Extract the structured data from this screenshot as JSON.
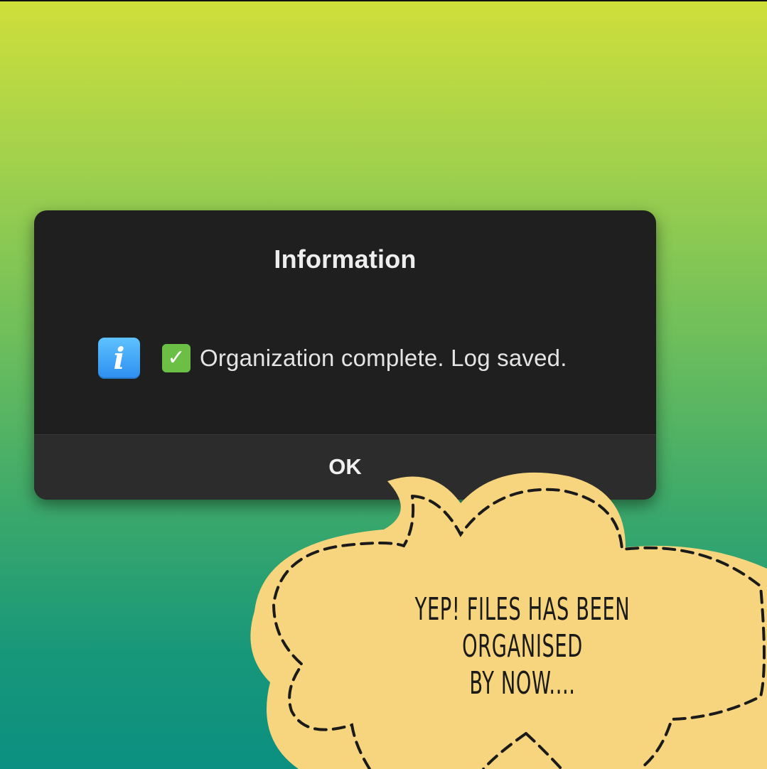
{
  "dialog": {
    "title": "Information",
    "info_icon_glyph": "i",
    "check_icon_glyph": "✓",
    "message": "Organization complete. Log saved.",
    "ok_label": "OK"
  },
  "callout": {
    "line1": "YEP! FILES HAS BEEN ORGANISED",
    "line2": "BY NOW....",
    "fill_color": "#f7d57e"
  },
  "colors": {
    "dialog_bg": "#1f1f1f",
    "footer_bg": "#2c2c2c",
    "info_blue": "#2d8ef0",
    "check_green": "#6cbf45"
  }
}
